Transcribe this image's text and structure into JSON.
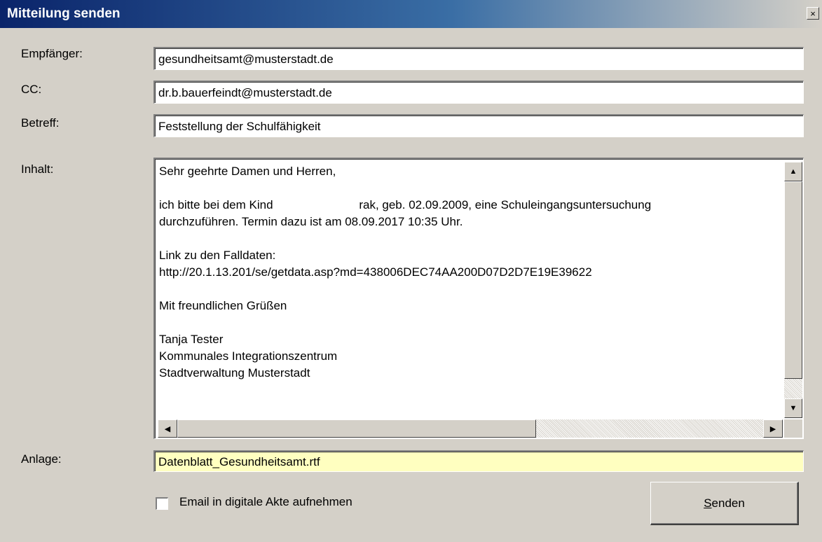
{
  "window": {
    "title": "Mitteilung senden",
    "close_glyph": "×"
  },
  "form": {
    "recipient_label": "Empfänger:",
    "recipient_value": "gesundheitsamt@musterstadt.de",
    "cc_label": "CC:",
    "cc_value": "dr.b.bauerfeindt@musterstadt.de",
    "subject_label": "Betreff:",
    "subject_value": "Feststellung der Schulfähigkeit",
    "content_label": "Inhalt:",
    "content_lines": [
      "Sehr geehrte Damen und Herren,",
      "",
      "ich bitte bei dem Kind                          rak, geb. 02.09.2009, eine Schuleingangsuntersuchung",
      "durchzuführen. Termin dazu ist am 08.09.2017 10:35 Uhr.",
      "",
      "Link zu den Falldaten:",
      "http://20.1.13.201/se/getdata.asp?md=438006DEC74AA200D07D2D7E19E39622",
      "",
      "Mit freundlichen Grüßen",
      "",
      "Tanja Tester",
      "Kommunales Integrationszentrum",
      "Stadtverwaltung Musterstadt"
    ],
    "attachment_label": "Anlage:",
    "attachment_value": "Datenblatt_Gesundheitsamt.rtf",
    "archive_checkbox_label": "Email in digitale Akte aufnehmen",
    "archive_checked": false,
    "send_button_mnemonic": "S",
    "send_button_rest": "enden"
  },
  "icons": {
    "scroll_up": "▲",
    "scroll_down": "▼",
    "scroll_left": "◀",
    "scroll_right": "▶"
  },
  "colors": {
    "titlebar_start": "#0a246a",
    "dialog_bg": "#d4d0c8",
    "attachment_bg": "#ffffc0"
  }
}
